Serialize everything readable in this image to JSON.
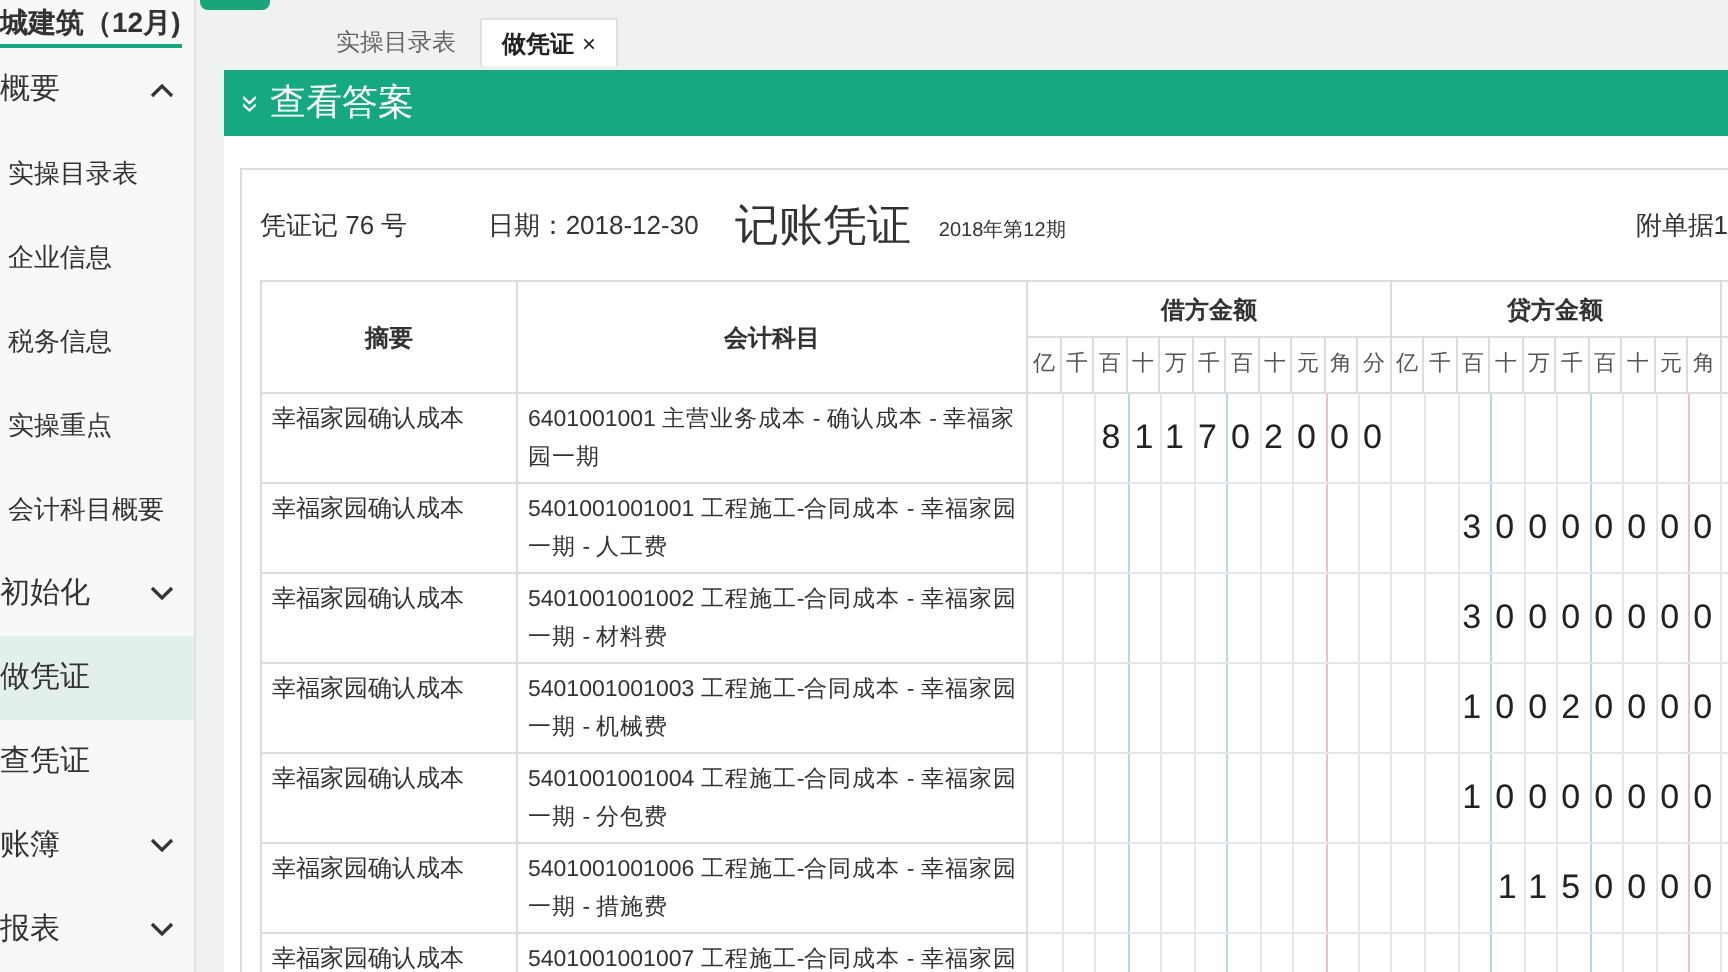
{
  "sidebar": {
    "title": "城建筑（12月)",
    "items": [
      {
        "label": "概要",
        "expanded": true,
        "selected": false,
        "children": [
          {
            "label": "实操目录表"
          },
          {
            "label": "企业信息"
          },
          {
            "label": "税务信息"
          },
          {
            "label": "实操重点"
          },
          {
            "label": "会计科目概要"
          }
        ]
      },
      {
        "label": "初始化",
        "expanded": false,
        "selected": false
      },
      {
        "label": "做凭证",
        "selected": true
      },
      {
        "label": "查凭证",
        "selected": false
      },
      {
        "label": "账簿",
        "expanded": false,
        "selected": false
      },
      {
        "label": "报表",
        "expanded": false,
        "selected": false
      }
    ]
  },
  "tabs": [
    {
      "label": "实操目录表",
      "selected": false
    },
    {
      "label": "做凭证",
      "selected": true,
      "close": "×"
    }
  ],
  "section_header": {
    "icon": "»",
    "title": "查看答案"
  },
  "voucher": {
    "number": "凭证记 76 号",
    "date": "日期：2018-12-30",
    "title": "记账凭证",
    "period": "2018年第12期",
    "attachments": "附单据1",
    "columns": {
      "summary": "摘要",
      "account": "会计科目",
      "debit": "借方金额",
      "credit": "贷方金额"
    },
    "debit_units": [
      "亿",
      "千",
      "百",
      "十",
      "万",
      "千",
      "百",
      "十",
      "元",
      "角",
      "分"
    ],
    "credit_units": [
      "亿",
      "千",
      "百",
      "十",
      "万",
      "千",
      "百",
      "十",
      "元",
      "角"
    ],
    "rows": [
      {
        "summary": "幸福家园确认成本",
        "account": "6401001001 主营业务成本 - 确认成本 - 幸福家园一期",
        "debit": "811702000",
        "credit": ""
      },
      {
        "summary": "幸福家园确认成本",
        "account": "5401001001001 工程施工-合同成本 - 幸福家园一期 - 人工费",
        "debit": "",
        "credit": "30000000"
      },
      {
        "summary": "幸福家园确认成本",
        "account": "5401001001002 工程施工-合同成本 - 幸福家园一期 - 材料费",
        "debit": "",
        "credit": "30000000"
      },
      {
        "summary": "幸福家园确认成本",
        "account": "5401001001003 工程施工-合同成本 - 幸福家园一期 - 机械费",
        "debit": "",
        "credit": "10020000"
      },
      {
        "summary": "幸福家园确认成本",
        "account": "5401001001004 工程施工-合同成本 - 幸福家园一期 - 分包费",
        "debit": "",
        "credit": "10000000"
      },
      {
        "summary": "幸福家园确认成本",
        "account": "5401001001006 工程施工-合同成本 - 幸福家园一期 - 措施费",
        "debit": "",
        "credit": "1150000"
      },
      {
        "summary": "幸福家园确认成本",
        "account": "5401001001007 工程施工-合同成本 - 幸福家园",
        "debit": "",
        "credit": ""
      }
    ]
  }
}
